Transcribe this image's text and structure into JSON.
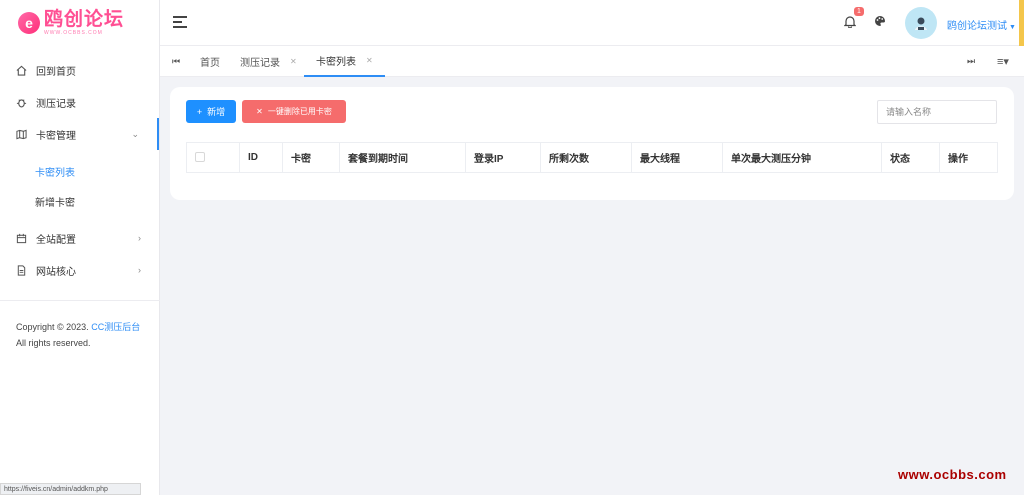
{
  "logo": {
    "mark": "e",
    "title": "鸥创论坛",
    "subtitle": "WWW.OCBBS.COM"
  },
  "sidebar": {
    "items": [
      {
        "label": "回到首页",
        "icon": "home-icon"
      },
      {
        "label": "测压记录",
        "icon": "bug-icon"
      },
      {
        "label": "卡密管理",
        "icon": "map-icon",
        "expanded": true
      },
      {
        "label": "全站配置",
        "icon": "calendar-icon"
      },
      {
        "label": "网站核心",
        "icon": "file-icon"
      }
    ],
    "sub_items": [
      {
        "label": "卡密列表",
        "active": true
      },
      {
        "label": "新增卡密",
        "active": false
      }
    ],
    "copyright": "Copyright © 2023.",
    "copyright_link": "CC测压后台",
    "rights": "All rights reserved."
  },
  "header": {
    "notification_count": "1",
    "username": "鸥创论坛测试"
  },
  "tabs": {
    "items": [
      {
        "label": "首页"
      },
      {
        "label": "测压记录"
      },
      {
        "label": "卡密列表",
        "active": true
      }
    ]
  },
  "toolbar": {
    "add_label": "新增",
    "delete_used_label": "一键删除已用卡密",
    "search_placeholder": "请输入名称"
  },
  "table": {
    "columns": [
      "ID",
      "卡密",
      "套餐到期时间",
      "登录IP",
      "所剩次数",
      "最大线程",
      "单次最大测压分钟",
      "状态",
      "操作"
    ]
  },
  "status_bar": {
    "url": "https://fiveis.cn/admin/addkm.php"
  },
  "watermark": "www.ocbbs.com",
  "colors": {
    "accent": "#2e8df5",
    "danger": "#f56c6c",
    "primary_button": "#1e90ff"
  }
}
